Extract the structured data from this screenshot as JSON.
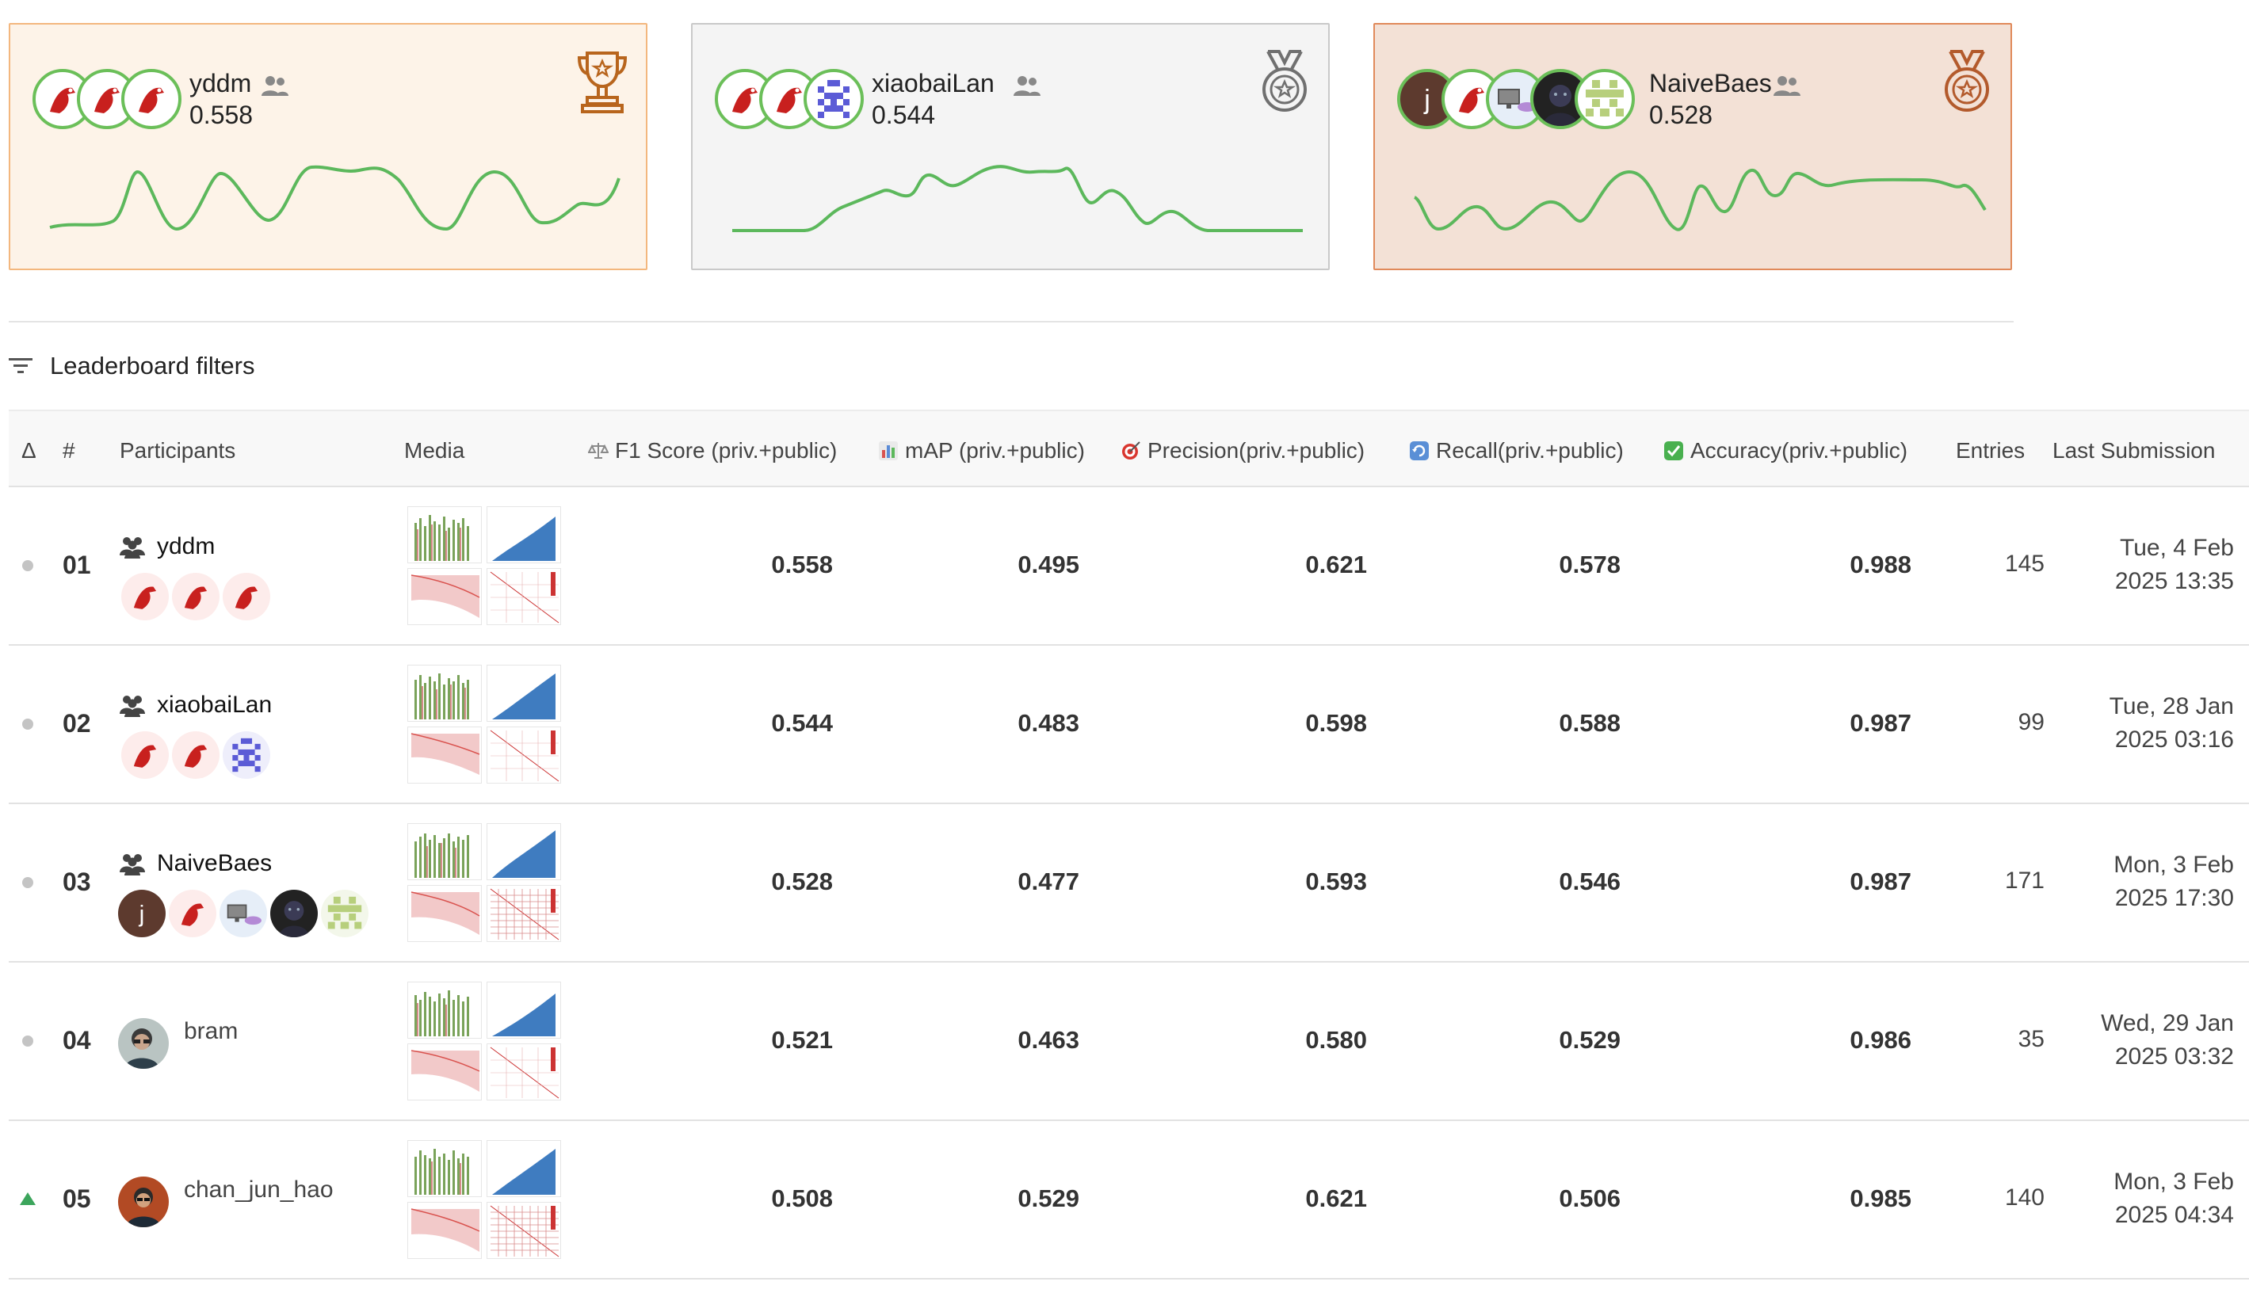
{
  "podium": [
    {
      "name": "yddm",
      "score": "0.558",
      "medal": "trophy-icon",
      "tier": "gold",
      "accent": "#f3b77e"
    },
    {
      "name": "xiaobaiLan",
      "score": "0.544",
      "medal": "silver-medal-icon",
      "tier": "silver",
      "accent": "#c9c9c9"
    },
    {
      "name": "NaiveBaes",
      "score": "0.528",
      "medal": "bronze-medal-icon",
      "tier": "bronze",
      "accent": "#e0895a"
    }
  ],
  "filters": {
    "label": "Leaderboard filters"
  },
  "table": {
    "headers": {
      "delta": "Δ",
      "rank": "#",
      "participants": "Participants",
      "media": "Media",
      "f1": "F1 Score (priv.+public)",
      "map": "mAP (priv.+public)",
      "precision": "Precision(priv.+public)",
      "recall": "Recall(priv.+public)",
      "accuracy": "Accuracy(priv.+public)",
      "entries": "Entries",
      "last": "Last Submission"
    },
    "rows": [
      {
        "rank": "01",
        "name": "yddm",
        "team": true,
        "trend": "same",
        "f1": "0.558",
        "map": "0.495",
        "precision": "0.621",
        "recall": "0.578",
        "accuracy": "0.988",
        "entries": "145",
        "date1": "Tue, 4 Feb",
        "date2": "2025 13:35"
      },
      {
        "rank": "02",
        "name": "xiaobaiLan",
        "team": true,
        "trend": "same",
        "f1": "0.544",
        "map": "0.483",
        "precision": "0.598",
        "recall": "0.588",
        "accuracy": "0.987",
        "entries": "99",
        "date1": "Tue, 28 Jan",
        "date2": "2025 03:16"
      },
      {
        "rank": "03",
        "name": "NaiveBaes",
        "team": true,
        "trend": "same",
        "f1": "0.528",
        "map": "0.477",
        "precision": "0.593",
        "recall": "0.546",
        "accuracy": "0.987",
        "entries": "171",
        "date1": "Mon, 3 Feb",
        "date2": "2025 17:30"
      },
      {
        "rank": "04",
        "name": "bram",
        "team": false,
        "trend": "same",
        "f1": "0.521",
        "map": "0.463",
        "precision": "0.580",
        "recall": "0.529",
        "accuracy": "0.986",
        "entries": "35",
        "date1": "Wed, 29 Jan",
        "date2": "2025 03:32"
      },
      {
        "rank": "05",
        "name": "chan_jun_hao",
        "team": false,
        "trend": "up",
        "f1": "0.508",
        "map": "0.529",
        "precision": "0.621",
        "recall": "0.506",
        "accuracy": "0.985",
        "entries": "140",
        "date1": "Mon, 3 Feb",
        "date2": "2025 04:34"
      }
    ]
  },
  "colors": {
    "line": "#5cb85c",
    "avatar_ring": "#6bbf59",
    "up_arrow": "#3ca55c"
  }
}
